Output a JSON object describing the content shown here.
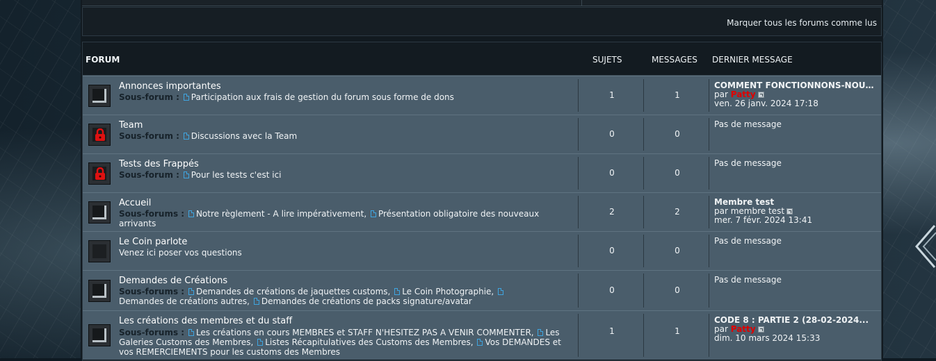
{
  "header": {
    "mark_all_read": "Marquer tous les forums comme lus",
    "col_forum": "FORUM",
    "col_topics": "SUJETS",
    "col_messages": "MESSAGES",
    "col_last": "DERNIER MESSAGE"
  },
  "colors": {
    "row_bg": "#4a5d6b",
    "admin_user": "#e00000",
    "link_icon": "#3fa5e0"
  },
  "forums": [
    {
      "title": "Annonces importantes",
      "icon": "forum-read-icon",
      "subforum_label": "Sous-forum :",
      "subforums": [
        "Participation aux frais de gestion du forum sous forme de dons"
      ],
      "topics": "1",
      "messages": "1",
      "last": {
        "title": "COMMENT FONCTIONNONS-NOUS ?",
        "by": "par",
        "user": "Patty",
        "date": "ven. 26 janv. 2024 17:18"
      }
    },
    {
      "title": "Team",
      "icon": "locked-icon",
      "subforum_label": "Sous-forum :",
      "subforums": [
        "Discussions avec la Team"
      ],
      "topics": "0",
      "messages": "0",
      "last": {
        "none": "Pas de message"
      }
    },
    {
      "title": "Tests des Frappés",
      "icon": "locked-icon",
      "subforum_label": "Sous-forum :",
      "subforums": [
        "Pour les tests c'est ici"
      ],
      "topics": "0",
      "messages": "0",
      "last": {
        "none": "Pas de message"
      }
    },
    {
      "title": "Accueil",
      "icon": "forum-read-icon",
      "subforum_label": "Sous-forums :",
      "subforums": [
        "Notre règlement - A lire impérativement,",
        "Présentation obligatoire des nouveaux arrivants"
      ],
      "topics": "2",
      "messages": "2",
      "last": {
        "title": "Membre test",
        "by": "par",
        "user": "membre test",
        "date": "mer. 7 févr. 2024 13:41"
      }
    },
    {
      "title": "Le Coin parlote",
      "icon": "forum-empty-icon",
      "description": "Venez ici poser vos questions",
      "topics": "0",
      "messages": "0",
      "last": {
        "none": "Pas de message"
      }
    },
    {
      "title": "Demandes de Créations",
      "icon": "forum-read-icon",
      "subforum_label": "Sous-forums :",
      "subforums": [
        "Demandes de créations de jaquettes customs,",
        "Le Coin Photographie,",
        "Demandes de créations autres,",
        "Demandes de créations de packs signature/avatar"
      ],
      "topics": "0",
      "messages": "0",
      "last": {
        "none": "Pas de message"
      }
    },
    {
      "title": "Les créations des membres et du staff",
      "icon": "forum-read-icon",
      "subforum_label": "Sous-forums :",
      "subforums": [
        "Les créations en cours MEMBRES et STAFF N'HESITEZ PAS A VENIR COMMENTER,",
        "Les Galeries Customs des Membres,",
        "Listes Récapitulatives des Customs des Membres,",
        "Vos DEMANDES et vos REMERCIEMENTS pour les customs des Membres"
      ],
      "topics": "1",
      "messages": "1",
      "last": {
        "title": "CODE 8 : PARTIE 2 (28-02-2024...",
        "by": "par",
        "user": "Patty",
        "date": "dim. 10 mars 2024 15:33"
      }
    }
  ]
}
